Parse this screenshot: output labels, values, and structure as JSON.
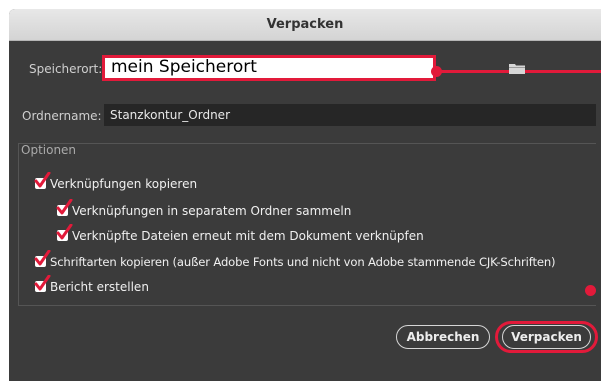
{
  "window": {
    "title": "Verpacken"
  },
  "location": {
    "label": "Speicherort:",
    "value": "mein Speicherort"
  },
  "folder": {
    "label": "Ordnername:",
    "value": "Stanzkontur_Ordner"
  },
  "options": {
    "group_label": "Optionen",
    "items": [
      {
        "label": "Verknüpfungen kopieren",
        "checked": true
      },
      {
        "label": "Verknüpfungen in separatem Ordner sammeln",
        "checked": true
      },
      {
        "label": "Verknüpfte Dateien erneut mit dem Dokument verknüpfen",
        "checked": true
      },
      {
        "label": "Schriftarten kopieren (außer Adobe Fonts und nicht von Adobe stammende CJK-Schriften)",
        "checked": true
      },
      {
        "label": "Bericht erstellen",
        "checked": true
      }
    ]
  },
  "buttons": {
    "cancel_label": "Abbrechen",
    "ok_label": "Verpacken"
  },
  "colors": {
    "annotation": "#e21a3a",
    "dialog_bg": "#3b3b3b",
    "field_bg": "#262626",
    "checkmark": "#e21a3a"
  }
}
